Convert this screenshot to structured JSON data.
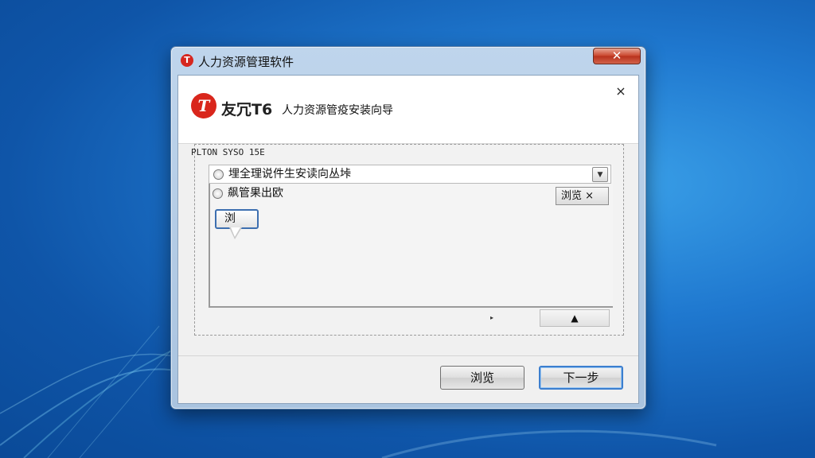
{
  "window": {
    "title": "人力资源管理软件",
    "icon_glyph": "T",
    "close_glyph": "✕"
  },
  "header": {
    "logo_glyph": "T",
    "brand_name": "友冗T6",
    "wizard_title": "人力资源管疫安装向导",
    "close_glyph": "×"
  },
  "group": {
    "label": "PLTON SYSO 15E"
  },
  "options": [
    {
      "label": "埋全理说件生安读向丛垰",
      "selected": false
    },
    {
      "label": "飙管果出欧",
      "selected": false
    }
  ],
  "combo": {
    "arrow_glyph": "▼"
  },
  "browse_chip": {
    "label": "浏览 ×"
  },
  "small_button": {
    "label": "浏"
  },
  "scroll": {
    "marker": "▸",
    "thumb_glyph": "▲"
  },
  "footer": {
    "browse_label": "浏览",
    "next_label": "下一步"
  },
  "colors": {
    "desktop_blue": "#1f78cf",
    "brand_red": "#d9261c",
    "close_red": "#c9432b",
    "focus_blue": "#3c7fcf"
  }
}
